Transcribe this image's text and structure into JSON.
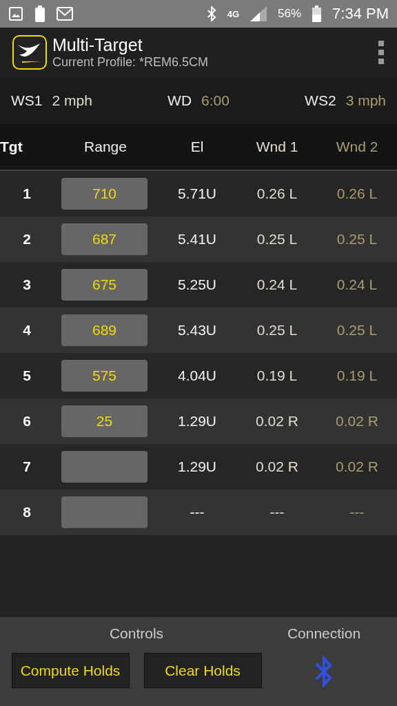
{
  "status_bar": {
    "network": "4G",
    "battery": "56%",
    "time": "7:34 PM"
  },
  "app_bar": {
    "title": "Multi-Target",
    "subtitle": "Current Profile: *REM6.5CM"
  },
  "wind": [
    {
      "label": "WS1",
      "value": "2 mph",
      "kind": "primary"
    },
    {
      "label": "WD",
      "value": "6:00",
      "kind": "secondary"
    },
    {
      "label": "WS2",
      "value": "3 mph",
      "kind": "secondary"
    }
  ],
  "table": {
    "columns": [
      "Tgt",
      "Range",
      "El",
      "Wnd 1",
      "Wnd 2"
    ],
    "rows": [
      {
        "tgt": "1",
        "range": "710",
        "el": "5.71U",
        "wnd1": "0.26 L",
        "wnd2": "0.26 L"
      },
      {
        "tgt": "2",
        "range": "687",
        "el": "5.41U",
        "wnd1": "0.25 L",
        "wnd2": "0.25 L"
      },
      {
        "tgt": "3",
        "range": "675",
        "el": "5.25U",
        "wnd1": "0.24 L",
        "wnd2": "0.24 L"
      },
      {
        "tgt": "4",
        "range": "689",
        "el": "5.43U",
        "wnd1": "0.25 L",
        "wnd2": "0.25 L"
      },
      {
        "tgt": "5",
        "range": "575",
        "el": "4.04U",
        "wnd1": "0.19 L",
        "wnd2": "0.19 L"
      },
      {
        "tgt": "6",
        "range": "25",
        "el": "1.29U",
        "wnd1": "0.02 R",
        "wnd2": "0.02 R"
      },
      {
        "tgt": "7",
        "el": "1.29U",
        "wnd1": "0.02 R",
        "wnd2": "0.02 R"
      },
      {
        "tgt": "8",
        "el": "---",
        "wnd1": "---",
        "wnd2": "---"
      }
    ]
  },
  "controls": {
    "title": "Controls",
    "buttons": [
      "Compute Holds",
      "Clear Holds"
    ]
  },
  "connection": {
    "title": "Connection"
  }
}
